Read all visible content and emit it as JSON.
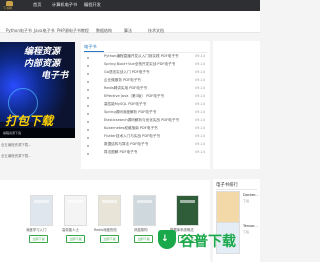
{
  "header": {
    "logo_text": "下书网",
    "nav": [
      "首页",
      "计算机电子书",
      "编程开发"
    ]
  },
  "subnav": [
    "Python电子书",
    "Java电子书",
    "PHP源电子书教程",
    "数据结构",
    "算法",
    "技术文档"
  ],
  "banner": {
    "line1": "编程资源",
    "line2": "内部资源",
    "line3": "电子书",
    "line4": "打包下载",
    "caption": "编程资源下载"
  },
  "left_links": [
    "全五编程资源下载...",
    "全五编程资源下载..."
  ],
  "panel": {
    "title": "电子书",
    "items": [
      {
        "title": "Python编程直播开发从入门到实践 PDF电子书",
        "date": "09-14"
      },
      {
        "title": "Spring Boot+Vue全栈开发实战 PDF电子书",
        "date": "09-14"
      },
      {
        "title": "Go语言实战入门 PDF电子书",
        "date": "09-14"
      },
      {
        "title": "企业微服务 PDF电子书",
        "date": "09-14"
      },
      {
        "title": "Redis精讲实用 PDF电子书",
        "date": "09-14"
      },
      {
        "title": "Effective Java（第3版） PDF电子书",
        "date": "09-14"
      },
      {
        "title": "高性能MySQL PDF电子书",
        "date": "09-14"
      },
      {
        "title": "Spring源码深度解析 PDF电子书",
        "date": "09-14"
      },
      {
        "title": "Elasticsearch源码解析与优化实战 PDF电子书",
        "date": "09-14"
      },
      {
        "title": "Kubernetes权威指南 PDF电子书",
        "date": "09-14"
      },
      {
        "title": "Flutter技术入门与实战 PDF电子书",
        "date": "09-14"
      },
      {
        "title": "数据结构与算法 PDF电子书",
        "date": "09-14"
      },
      {
        "title": "算法图解 PDF电子书",
        "date": "09-14"
      }
    ]
  },
  "shelf": {
    "books": [
      {
        "title": "深度学习入门",
        "color": "#dfe6ee"
      },
      {
        "title": "高效能人士",
        "color": "#f4f4f4"
      },
      {
        "title": "Redis深度历险",
        "color": "#e9e4d8"
      },
      {
        "title": "凤凰架构",
        "color": "#cfd8dc"
      },
      {
        "title": "数据库系统概念",
        "color": "#2f5d3a"
      }
    ],
    "button_label": "立即下载"
  },
  "rank": {
    "title": "电子书排行",
    "items": [
      {
        "title": "Docker...",
        "sub": "下载"
      },
      {
        "title": "Tensor...",
        "sub": "下载"
      }
    ]
  },
  "watermark": {
    "text": "谷普下载",
    "icon": "shield-icon"
  }
}
